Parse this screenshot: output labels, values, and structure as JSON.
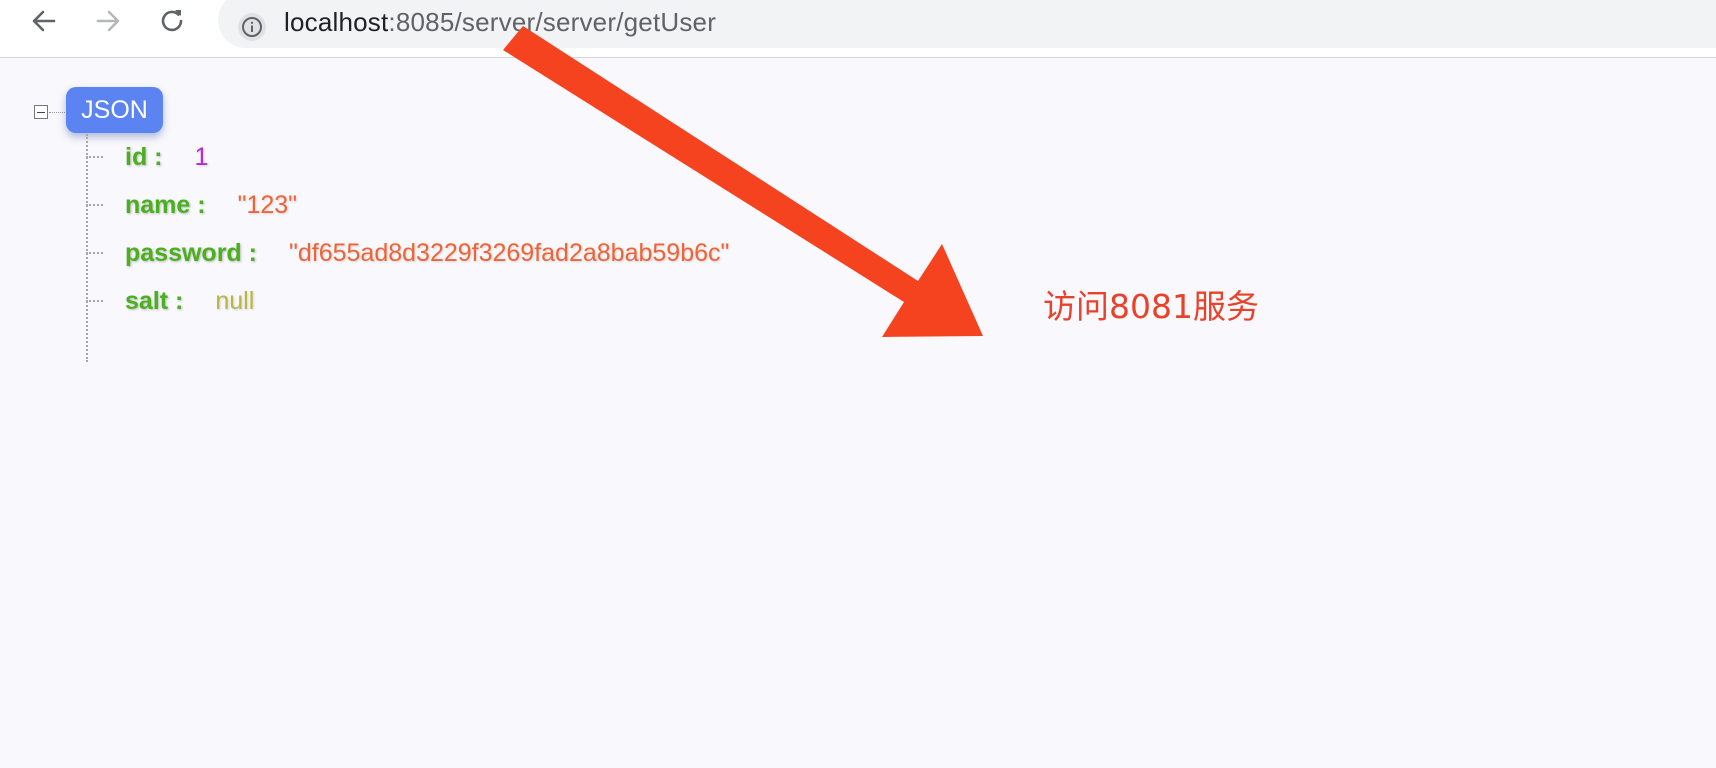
{
  "browser": {
    "url_host": "localhost",
    "url_rest": ":8085/server/server/getUser",
    "icons": {
      "back": "arrow-left-icon",
      "forward": "arrow-right-icon",
      "reload": "reload-icon",
      "info": "info-icon"
    }
  },
  "json_viewer": {
    "root_label": "JSON",
    "fields": [
      {
        "key": "id :",
        "value": "1",
        "type": "number"
      },
      {
        "key": "name :",
        "value": "\"123\"",
        "type": "string"
      },
      {
        "key": "password :",
        "value": "\"df655ad8d3229f3269fad2a8bab59b6c\"",
        "type": "string"
      },
      {
        "key": "salt :",
        "value": "null",
        "type": "null"
      }
    ]
  },
  "annotation": {
    "text": "访问8081服务",
    "color": "#e8422a"
  },
  "colors": {
    "key": "#4caf1f",
    "number": "#b42ad6",
    "string": "#ef6436",
    "null": "#b9b645",
    "badge": "#5b84f2",
    "arrow": "#f5421f"
  }
}
